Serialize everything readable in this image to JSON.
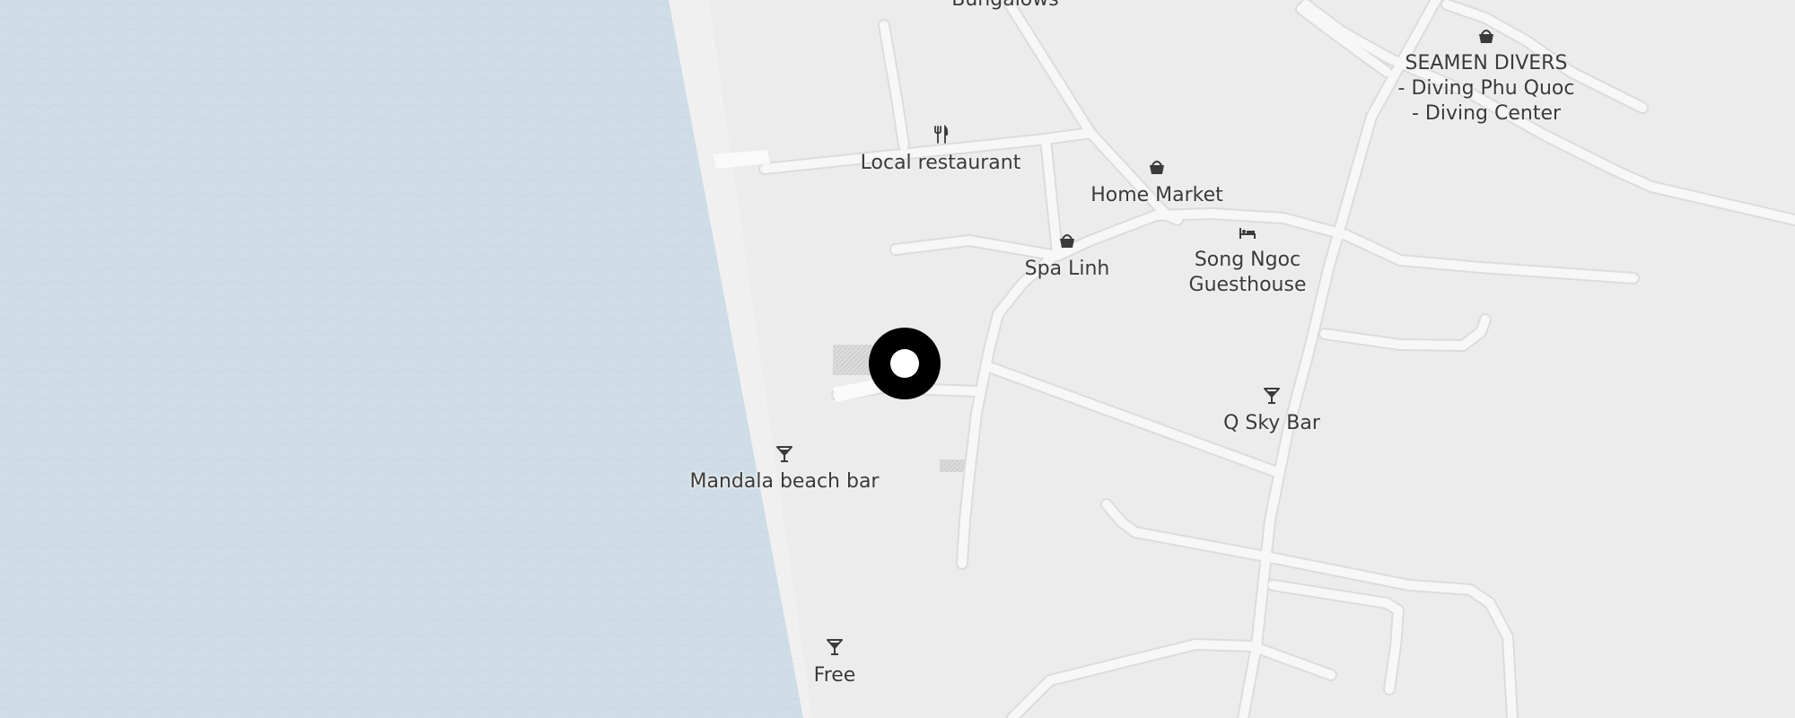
{
  "map": {
    "colors": {
      "water": "#cfdde7",
      "land": "#ececec",
      "beach": "#f2f2f2",
      "road": "#f7f7f7",
      "road_edge": "#dedede",
      "label": "#3a3a3a",
      "pin": "#000000"
    },
    "pois": [
      {
        "id": "bungalows",
        "label": "Bungalows",
        "icon": "none"
      },
      {
        "id": "local-restaurant",
        "label": "Local restaurant",
        "icon": "fork-knife-icon"
      },
      {
        "id": "home-market",
        "label": "Home Market",
        "icon": "shopping-basket-icon"
      },
      {
        "id": "spa-linh",
        "label": "Spa Linh",
        "icon": "shopping-basket-icon"
      },
      {
        "id": "song-ngoc",
        "label": "Song Ngoc\nGuesthouse",
        "icon": "bed-icon"
      },
      {
        "id": "seamen-divers",
        "label": "SEAMEN DIVERS\n- Diving Phu Quoc\n- Diving Center",
        "icon": "shopping-basket-icon"
      },
      {
        "id": "q-sky-bar",
        "label": "Q Sky Bar",
        "icon": "cocktail-glass-icon"
      },
      {
        "id": "mandala-beach-bar",
        "label": "Mandala beach bar",
        "icon": "cocktail-glass-icon"
      },
      {
        "id": "free",
        "label": "Free",
        "icon": "cocktail-glass-icon"
      }
    ],
    "selected_marker": {
      "icon": "location-pin-icon"
    }
  }
}
